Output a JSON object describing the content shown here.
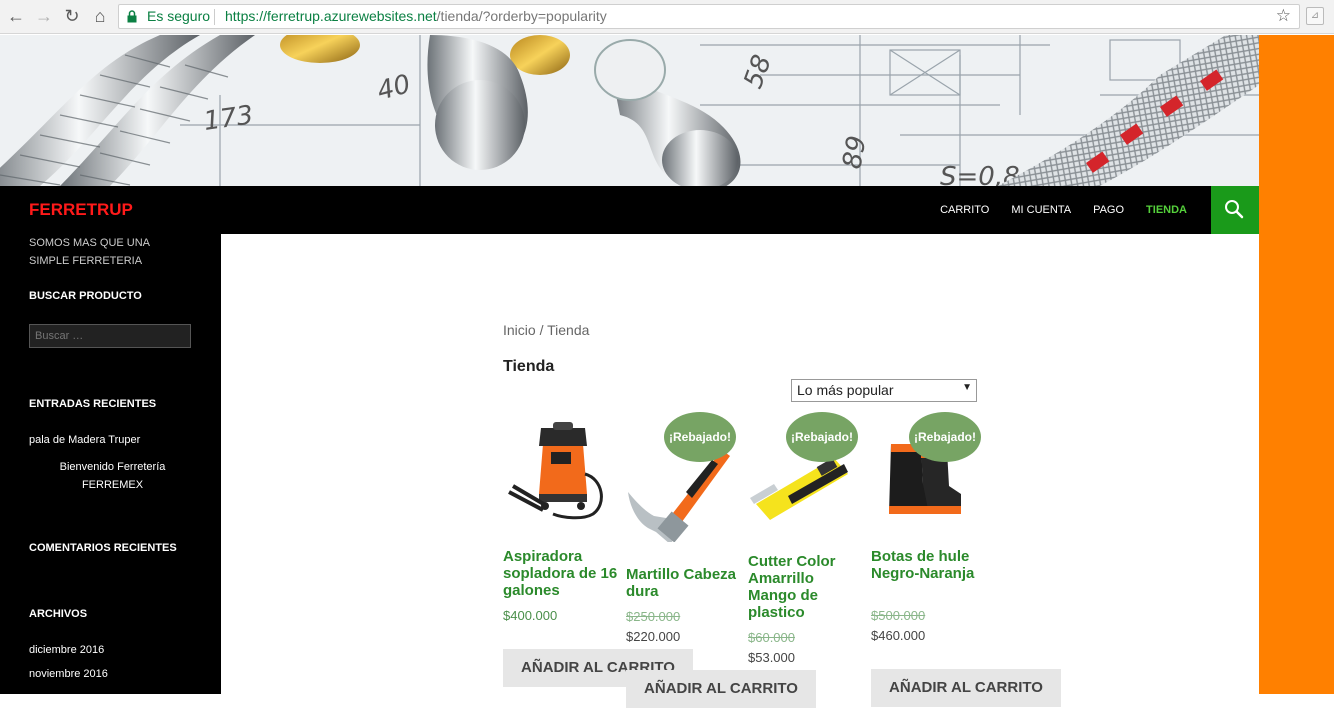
{
  "browser": {
    "secure_label": "Es seguro",
    "url_host": "https://ferretrup.azurewebsites.net",
    "url_path": "/tienda/?orderby=popularity"
  },
  "site": {
    "title": "FERRETRUP",
    "tagline": "SOMOS MAS QUE UNA SIMPLE FERRETERIA"
  },
  "menu": [
    {
      "label": "CARRITO",
      "active": false
    },
    {
      "label": "MI CUENTA",
      "active": false
    },
    {
      "label": "PAGO",
      "active": false
    },
    {
      "label": "TIENDA",
      "active": true
    }
  ],
  "sidebar": {
    "search_title": "BUSCAR PRODUCTO",
    "search_placeholder": "Buscar …",
    "recent_posts_title": "ENTRADAS RECIENTES",
    "recent_posts": [
      "pala de Madera Truper",
      "Bienvenido Ferretería FERREMEX"
    ],
    "recent_comments_title": "COMENTARIOS RECIENTES",
    "archives_title": "ARCHIVOS",
    "archives": [
      "diciembre 2016",
      "noviembre 2016"
    ]
  },
  "shop": {
    "breadcrumb": "Inicio / Tienda",
    "title": "Tienda",
    "orderby_selected": "Lo más popular",
    "sale_badge": "¡Rebajado!",
    "add_to_cart": "AÑADIR AL CARRITO",
    "products": [
      {
        "name": "Aspiradora sopladora de 16 galones",
        "price": "$400.000",
        "old_price": null,
        "on_sale": false
      },
      {
        "name": "Martillo Cabeza dura",
        "price": "$220.000",
        "old_price": "$250.000",
        "on_sale": true
      },
      {
        "name": "Cutter Color Amarrillo Mango de plastico",
        "price": "$53.000",
        "old_price": "$60.000",
        "on_sale": true
      },
      {
        "name": "Botas de hule Negro-Naranja",
        "price": "$460.000",
        "old_price": "$500.000",
        "on_sale": true
      }
    ]
  },
  "colors": {
    "accent_orange": "#ff8000",
    "site_title_red": "#ff1a1a",
    "menu_active_green": "#55d13b",
    "search_button_green": "#1a9a1a",
    "product_title_green": "#2b8a2b",
    "sale_badge_green": "#77a464"
  }
}
